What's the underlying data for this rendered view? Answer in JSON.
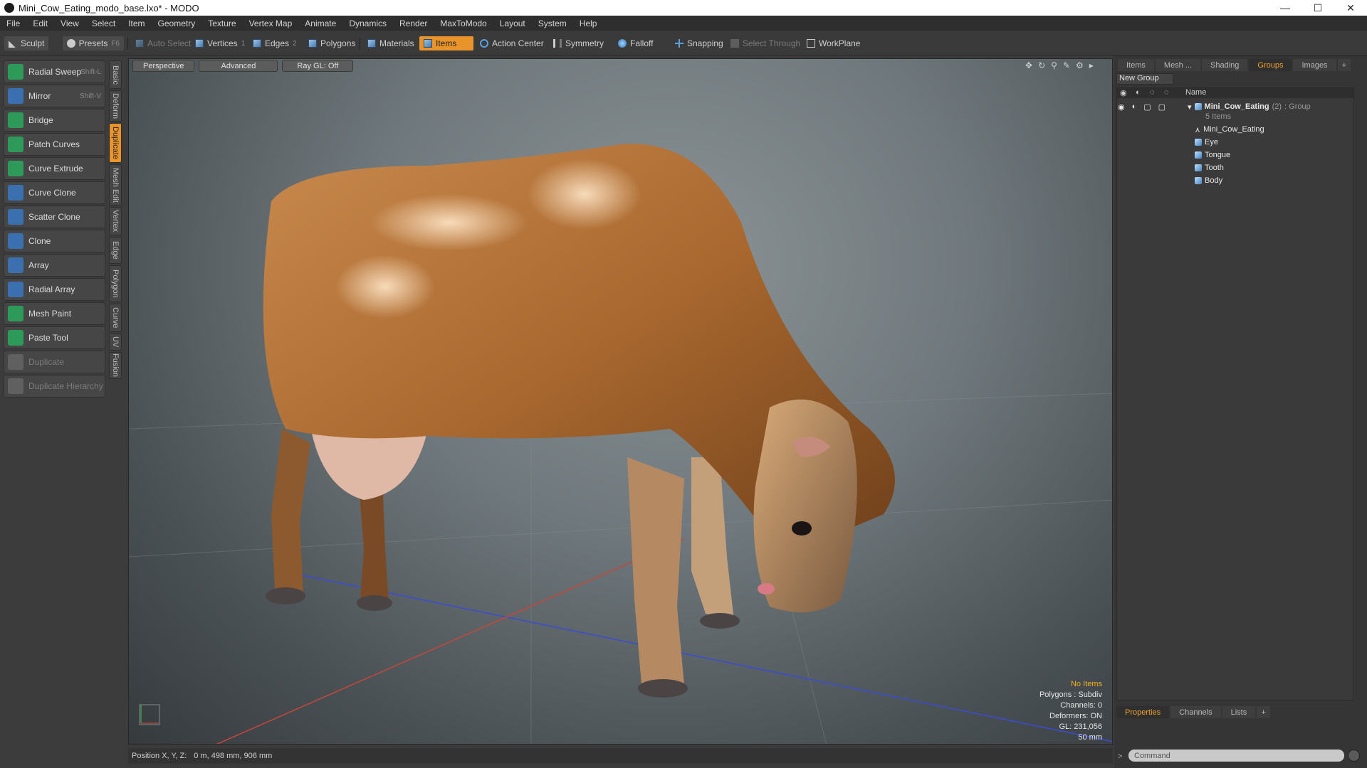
{
  "window": {
    "title": "Mini_Cow_Eating_modo_base.lxo* - MODO",
    "controls": [
      "—",
      "☐",
      "✕"
    ]
  },
  "menu": [
    "File",
    "Edit",
    "View",
    "Select",
    "Item",
    "Geometry",
    "Texture",
    "Vertex Map",
    "Animate",
    "Dynamics",
    "Render",
    "MaxToModo",
    "Layout",
    "System",
    "Help"
  ],
  "toolbar": {
    "sculpt": "Sculpt",
    "presets": "Presets",
    "presets_key": "F6",
    "auto_select": "Auto Select",
    "vertices": "Vertices",
    "vertices_count": "1",
    "edges": "Edges",
    "edges_count": "2",
    "polygons": "Polygons",
    "materials": "Materials",
    "items": "Items",
    "action_center": "Action Center",
    "symmetry": "Symmetry",
    "falloff": "Falloff",
    "snapping": "Snapping",
    "select_through": "Select Through",
    "workplane": "WorkPlane"
  },
  "tools": [
    {
      "label": "Radial Sweep",
      "key": "Shift-L",
      "color": "#2e9a5a"
    },
    {
      "label": "Mirror",
      "key": "Shift-V",
      "color": "#3a6fb0"
    },
    {
      "label": "Bridge",
      "key": "",
      "color": "#2e9a5a"
    },
    {
      "label": "Patch Curves",
      "key": "",
      "color": "#2e9a5a"
    },
    {
      "label": "Curve Extrude",
      "key": "",
      "color": "#2e9a5a"
    },
    {
      "label": "Curve Clone",
      "key": "",
      "color": "#3a6fb0"
    },
    {
      "label": "Scatter Clone",
      "key": "",
      "color": "#3a6fb0"
    },
    {
      "label": "Clone",
      "key": "",
      "color": "#3a6fb0"
    },
    {
      "label": "Array",
      "key": "",
      "color": "#3a6fb0"
    },
    {
      "label": "Radial Array",
      "key": "",
      "color": "#3a6fb0"
    },
    {
      "label": "Mesh Paint",
      "key": "",
      "color": "#2e9a5a"
    },
    {
      "label": "Paste Tool",
      "key": "",
      "color": "#2e9a5a"
    },
    {
      "label": "Duplicate",
      "key": "",
      "color": "#888888",
      "disabled": true
    },
    {
      "label": "Duplicate Hierarchy",
      "key": "",
      "color": "#888888",
      "disabled": true
    }
  ],
  "vtabs": [
    "Basic",
    "Deform",
    "Duplicate",
    "Mesh Edit",
    "Vertex",
    "Edge",
    "Polygon",
    "Curve",
    "UV",
    "Fusion"
  ],
  "vtabs_active": "Duplicate",
  "viewport": {
    "perspective": "Perspective",
    "advanced": "Advanced",
    "raygl": "Ray GL: Off",
    "info": {
      "selection": "No Items",
      "polygons": "Polygons : Subdiv",
      "channels": "Channels: 0",
      "deformers": "Deformers: ON",
      "gl": "GL: 231,056",
      "focal": "50 mm"
    },
    "status_label": "Position X, Y, Z:",
    "status_value": "0 m, 498 mm, 906 mm"
  },
  "rightpanel": {
    "tabs": [
      "Items",
      "Mesh ...",
      "Shading",
      "Groups",
      "Images"
    ],
    "active_tab": "Groups",
    "new_group": "New Group",
    "col_name": "Name",
    "group": {
      "name": "Mini_Cow_Eating",
      "count": "(2)",
      "type": ": Group",
      "subtitle": "5 Items"
    },
    "children": [
      "Mini_Cow_Eating",
      "Eye",
      "Tongue",
      "Tooth",
      "Body"
    ],
    "bottom_tabs": [
      "Properties",
      "Channels",
      "Lists"
    ],
    "command_placeholder": "Command"
  }
}
